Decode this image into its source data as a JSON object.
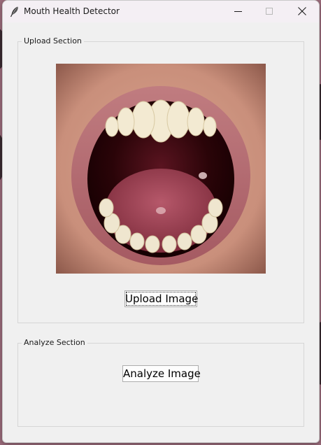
{
  "window": {
    "title": "Mouth Health Detector",
    "icon": "feather-icon",
    "controls": [
      "minimize-icon",
      "maximize-icon",
      "close-icon"
    ]
  },
  "upload_section": {
    "label": "Upload Section",
    "image_description": "Photo of an open mouth showing upper and lower teeth, tongue and lips",
    "button_label": "Upload Image"
  },
  "analyze_section": {
    "label": "Analyze Section",
    "button_label": "Analyze Image"
  },
  "colors": {
    "window_bg": "#f0f0f0",
    "titlebar_bg": "#f4eff4",
    "button_bg": "#fdfdfd",
    "group_border": "#d6d6d6"
  }
}
